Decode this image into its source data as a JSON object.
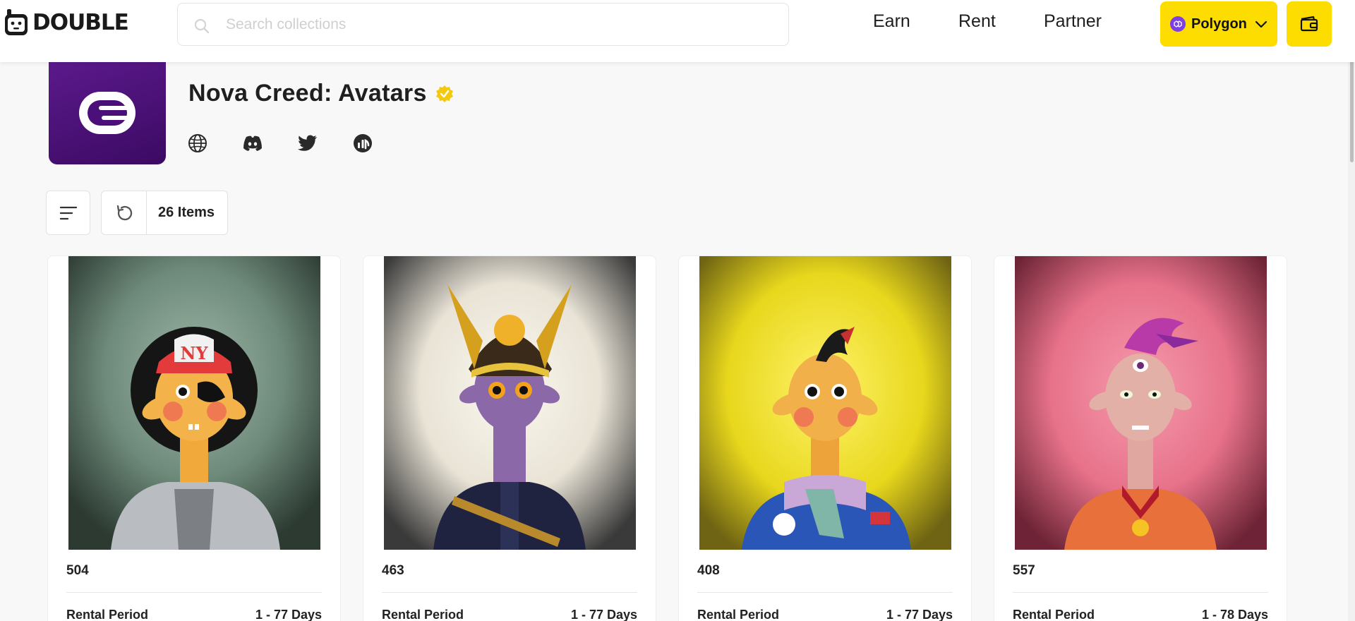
{
  "header": {
    "logo_text": "DOUBLE",
    "search": {
      "placeholder": "Search collections",
      "value": ""
    },
    "nav": [
      {
        "label": "Earn"
      },
      {
        "label": "Rent"
      },
      {
        "label": "Partner"
      }
    ],
    "network": {
      "label": "Polygon",
      "icon": "polygon-icon",
      "color": "#FDDD00"
    },
    "wallet": {
      "icon": "wallet-icon"
    }
  },
  "collection": {
    "title": "Nova Creed: Avatars",
    "verified_icon": "verified-badge-icon",
    "logo_bg": "#4A0F78",
    "social": [
      {
        "icon": "globe-icon"
      },
      {
        "icon": "discord-icon"
      },
      {
        "icon": "twitter-icon"
      },
      {
        "icon": "stats-icon"
      }
    ]
  },
  "toolbar": {
    "filter_icon": "filter-lines-icon",
    "refresh_icon": "refresh-icon",
    "count_label": "26 Items"
  },
  "cards": [
    {
      "id": "504",
      "rental_label": "Rental Period",
      "rental_value": "1 - 77 Days",
      "bg": "#5e7a6a"
    },
    {
      "id": "463",
      "rental_label": "Rental Period",
      "rental_value": "1 - 77 Days",
      "bg": "#e9e3d6"
    },
    {
      "id": "408",
      "rental_label": "Rental Period",
      "rental_value": "1 - 77 Days",
      "bg": "#e8d71c"
    },
    {
      "id": "557",
      "rental_label": "Rental Period",
      "rental_value": "1 - 78 Days",
      "bg": "#e7728a"
    }
  ]
}
